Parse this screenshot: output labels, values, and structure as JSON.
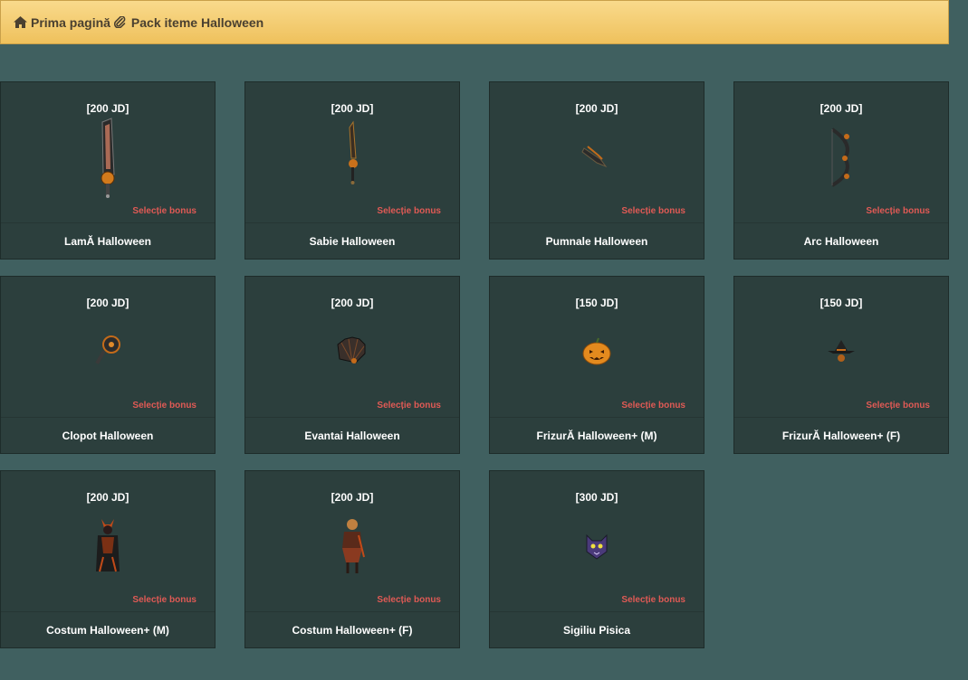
{
  "breadcrumb": {
    "home_label": "Prima pagină",
    "current_label": "Pack iteme Halloween",
    "home_icon": "home-icon",
    "current_icon": "paperclip-icon"
  },
  "items": [
    {
      "price": "[200 JD]",
      "bonus": "Selecție bonus",
      "name": "LamĂ Halloween",
      "icon": "blade-icon"
    },
    {
      "price": "[200 JD]",
      "bonus": "Selecție bonus",
      "name": "Sabie Halloween",
      "icon": "sword-icon"
    },
    {
      "price": "[200 JD]",
      "bonus": "Selecție bonus",
      "name": "Pumnale Halloween",
      "icon": "dagger-icon"
    },
    {
      "price": "[200 JD]",
      "bonus": "Selecție bonus",
      "name": "Arc Halloween",
      "icon": "bow-icon"
    },
    {
      "price": "[200 JD]",
      "bonus": "Selecție bonus",
      "name": "Clopot Halloween",
      "icon": "bell-icon"
    },
    {
      "price": "[200 JD]",
      "bonus": "Selecție bonus",
      "name": "Evantai Halloween",
      "icon": "fan-icon"
    },
    {
      "price": "[150 JD]",
      "bonus": "Selecție bonus",
      "name": "FrizurĂ Halloween+ (M)",
      "icon": "pumpkin-icon"
    },
    {
      "price": "[150 JD]",
      "bonus": "Selecție bonus",
      "name": "FrizurĂ Halloween+ (F)",
      "icon": "witch-hat-icon"
    },
    {
      "price": "[200 JD]",
      "bonus": "Selecție bonus",
      "name": "Costum Halloween+ (M)",
      "icon": "costume-male-icon"
    },
    {
      "price": "[200 JD]",
      "bonus": "Selecție bonus",
      "name": "Costum Halloween+ (F)",
      "icon": "costume-female-icon"
    },
    {
      "price": "[300 JD]",
      "bonus": "Selecție bonus",
      "name": "Sigiliu Pisica",
      "icon": "cat-seal-icon"
    }
  ]
}
